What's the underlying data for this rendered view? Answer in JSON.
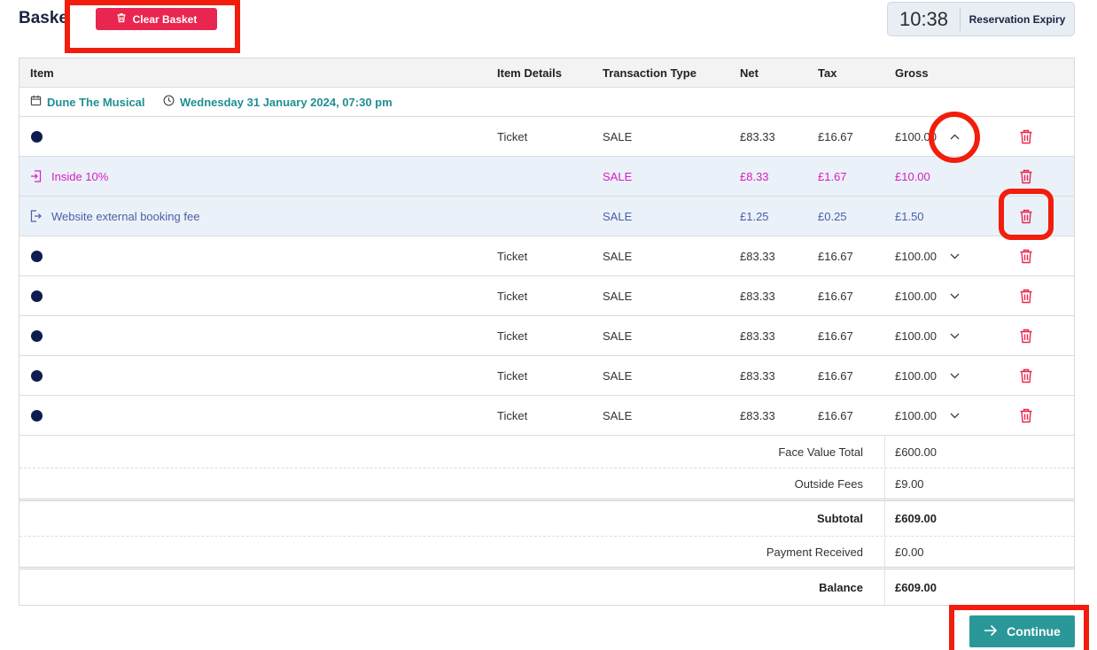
{
  "header": {
    "title": "Basket",
    "clear_label": "Clear Basket",
    "expiry_time": "10:38",
    "expiry_label": "Reservation Expiry"
  },
  "columns": [
    "Item",
    "Item Details",
    "Transaction Type",
    "Net",
    "Tax",
    "Gross"
  ],
  "event": {
    "name": "Dune The Musical",
    "datetime": "Wednesday 31 January 2024, 07:30 pm"
  },
  "rows": [
    {
      "details": "Ticket",
      "type": "SALE",
      "net": "£83.33",
      "tax": "£16.67",
      "gross": "£100.00"
    },
    {
      "label": "Inside 10%",
      "type": "SALE",
      "net": "£8.33",
      "tax": "£1.67",
      "gross": "£10.00"
    },
    {
      "label": "Website external booking fee",
      "type": "SALE",
      "net": "£1.25",
      "tax": "£0.25",
      "gross": "£1.50"
    },
    {
      "details": "Ticket",
      "type": "SALE",
      "net": "£83.33",
      "tax": "£16.67",
      "gross": "£100.00"
    },
    {
      "details": "Ticket",
      "type": "SALE",
      "net": "£83.33",
      "tax": "£16.67",
      "gross": "£100.00"
    },
    {
      "details": "Ticket",
      "type": "SALE",
      "net": "£83.33",
      "tax": "£16.67",
      "gross": "£100.00"
    },
    {
      "details": "Ticket",
      "type": "SALE",
      "net": "£83.33",
      "tax": "£16.67",
      "gross": "£100.00"
    },
    {
      "details": "Ticket",
      "type": "SALE",
      "net": "£83.33",
      "tax": "£16.67",
      "gross": "£100.00"
    }
  ],
  "summary": {
    "face_value_label": "Face Value Total",
    "face_value": "£600.00",
    "outside_fees_label": "Outside Fees",
    "outside_fees": "£9.00",
    "subtotal_label": "Subtotal",
    "subtotal": "£609.00",
    "payment_label": "Payment Received",
    "payment": "£0.00",
    "balance_label": "Balance",
    "balance": "£609.00"
  },
  "footer": {
    "continue_label": "Continue"
  },
  "colors": {
    "accent": "#2a9899",
    "danger": "#e8264f",
    "highlight": "#f21d0c",
    "dot": "#0e1c4f"
  },
  "icons": [
    "trash-icon",
    "calendar-icon",
    "clock-icon",
    "chevron-up-icon",
    "chevron-down-icon",
    "arrow-right-icon",
    "login-icon",
    "logout-icon"
  ]
}
